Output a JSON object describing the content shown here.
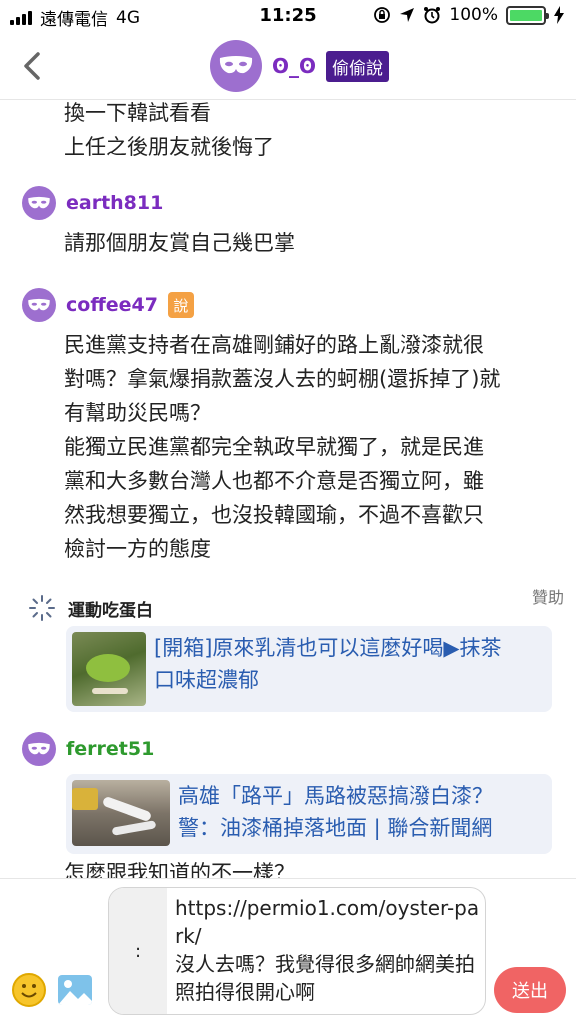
{
  "status_bar": {
    "carrier": "遠傳電信",
    "network": "4G",
    "time": "11:25",
    "battery": "100%",
    "battery_level": 1.0
  },
  "header": {
    "username": "ʘ_ʘ",
    "badge": "偷偷說"
  },
  "messages": [
    {
      "lines": [
        "換一下韓試看看",
        "上任之後朋友就後悔了"
      ]
    },
    {
      "user": "earth811",
      "user_color": "#7b2cbf",
      "lines": [
        "請那個朋友賞自己幾巴掌"
      ]
    },
    {
      "user": "coffee47",
      "user_color": "#7b2cbf",
      "badge": "說",
      "lines": [
        "民進黨支持者在高雄剛鋪好的路上亂潑漆就很",
        "對嗎？拿氣爆捐款蓋沒人去的蚵棚(還拆掉了)就",
        "有幫助災民嗎？",
        "能獨立民進黨都完全執政早就獨了，就是民進",
        "黨和大多數台灣人也都不介意是否獨立阿，雖",
        "然我想要獨立，也沒投韓國瑜，不過不喜歡只",
        "檢討一方的態度"
      ]
    },
    {
      "user": "ferret51",
      "user_color": "#2e9a2e",
      "partial_line": "怎麼跟我知道的不一樣？"
    }
  ],
  "sponsor": {
    "label": "贊助",
    "name": "運動吃蛋白",
    "card_lines": [
      "[開箱]原來乳清也可以這麼好喝▶抹茶",
      "口味超濃郁"
    ]
  },
  "link_card": {
    "lines": [
      "高雄「路平」馬路被惡搞潑白漆？",
      "警：油漆桶掉落地面 | 聯合新聞網"
    ]
  },
  "composer": {
    "prefix": ":",
    "text": "https://permio1.com/oyster-park/\n沒人去嗎？我覺得很多網帥網美拍照拍得很開心啊",
    "send_label": "送出"
  }
}
